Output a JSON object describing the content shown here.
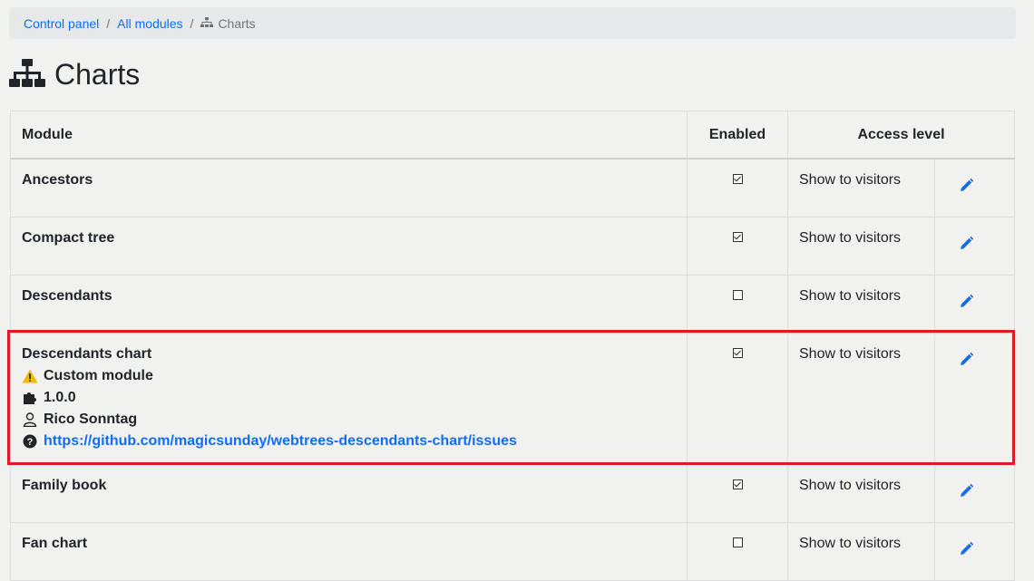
{
  "breadcrumb": {
    "control_panel": "Control panel",
    "all_modules": "All modules",
    "current": "Charts"
  },
  "page_title": "Charts",
  "table": {
    "headers": {
      "module": "Module",
      "enabled": "Enabled",
      "access": "Access level"
    },
    "rows": [
      {
        "name": "Ancestors",
        "enabled": true,
        "access": "Show to visitors"
      },
      {
        "name": "Compact tree",
        "enabled": true,
        "access": "Show to visitors"
      },
      {
        "name": "Descendants",
        "enabled": false,
        "access": "Show to visitors"
      },
      {
        "name": "Descendants chart",
        "enabled": true,
        "access": "Show to visitors",
        "custom_label": "Custom module",
        "version": "1.0.0",
        "author": "Rico Sonntag",
        "support_url": "https://github.com/magicsunday/webtrees-descendants-chart/issues"
      },
      {
        "name": "Family book",
        "enabled": true,
        "access": "Show to visitors"
      },
      {
        "name": "Fan chart",
        "enabled": false,
        "access": "Show to visitors"
      }
    ]
  },
  "colors": {
    "link": "#0d6efd",
    "highlight": "#e01a22",
    "warning": "#f5b800"
  }
}
